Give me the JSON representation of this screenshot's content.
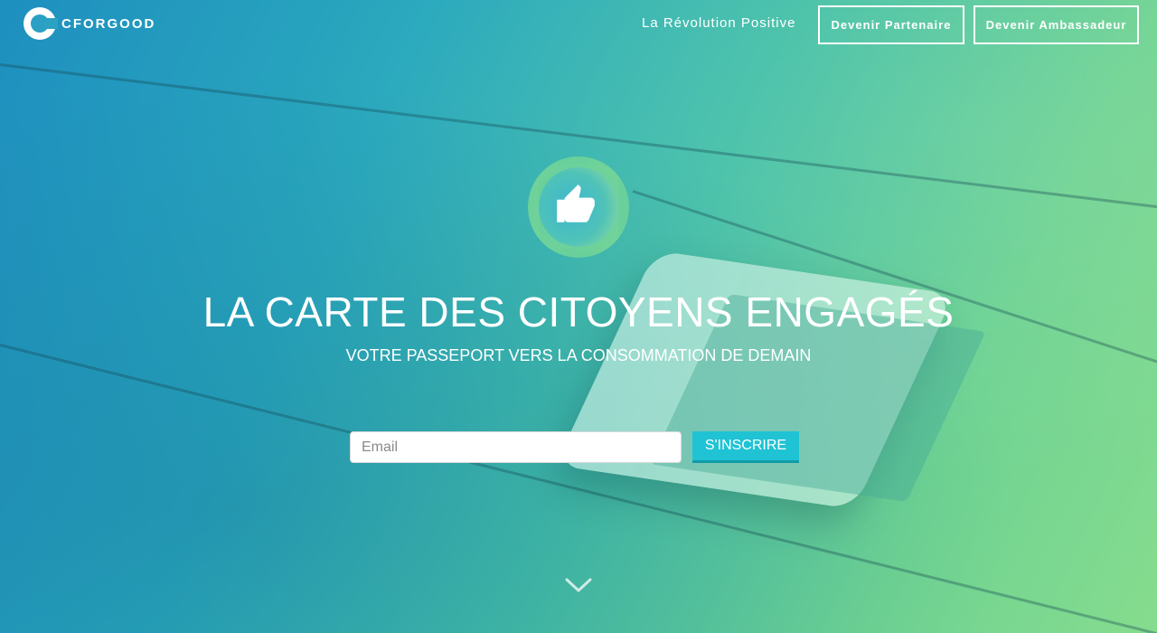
{
  "brand": {
    "name": "CFORGOOD"
  },
  "header": {
    "tagline": "La Révolution Positive",
    "partner_label": "Devenir Partenaire",
    "ambassador_label": "Devenir Ambassadeur"
  },
  "hero": {
    "title": "LA CARTE DES CITOYENS ENGAGÉS",
    "subtitle": "VOTRE PASSEPORT VERS LA CONSOMMATION DE DEMAIN"
  },
  "signup": {
    "email_placeholder": "Email",
    "submit_label": "S'INSCRIRE"
  },
  "icons": {
    "logo": "cforgood-logo-icon",
    "emblem": "thumbs-up-emblem-icon",
    "scroll": "chevron-down-icon"
  },
  "colors": {
    "gradient_start": "#1e8fbf",
    "gradient_end": "#86dc8e",
    "accent_button": "#1fc3d4"
  }
}
